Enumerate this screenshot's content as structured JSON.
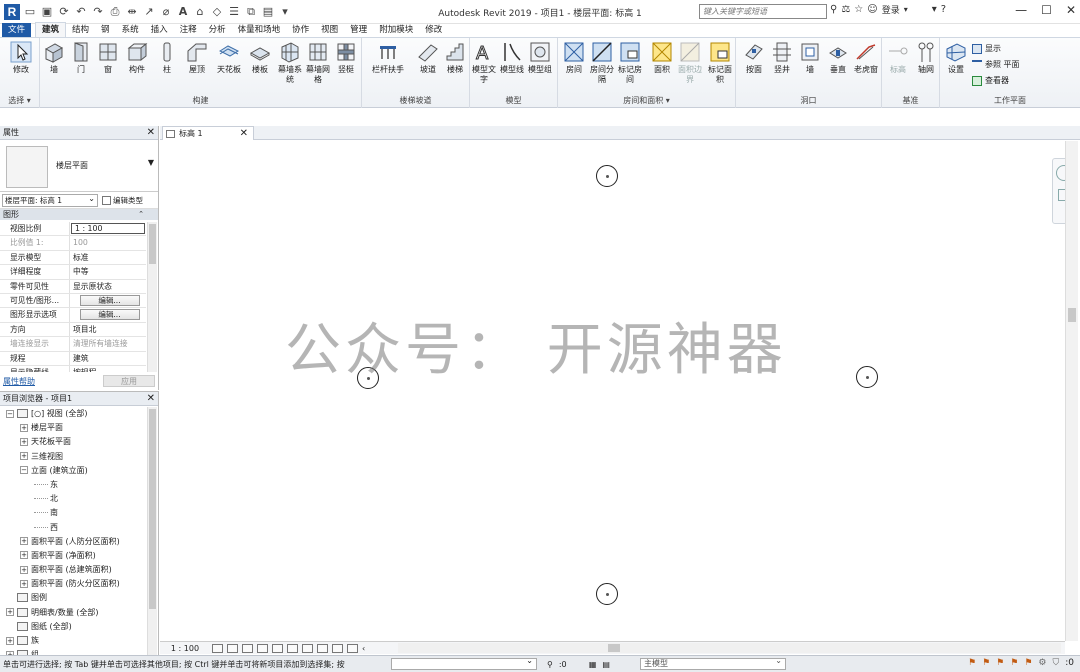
{
  "title": "Autodesk Revit 2019 - 项目1 - 楼层平面: 标高 1",
  "search_placeholder": "键入关键字或短语",
  "user_label": "登录",
  "tabs": [
    "文件",
    "建筑",
    "结构",
    "钢",
    "系统",
    "插入",
    "注释",
    "分析",
    "体量和场地",
    "协作",
    "视图",
    "管理",
    "附加模块",
    "修改"
  ],
  "active_tab": "建筑",
  "ribbon": {
    "select": {
      "label": "修改",
      "panel": "选择"
    },
    "build": {
      "panel": "构建",
      "buttons": [
        "墙",
        "门",
        "窗",
        "构件",
        "柱",
        "屋顶",
        "天花板",
        "楼板",
        "幕墙系统",
        "幕墙网格",
        "竖梃"
      ]
    },
    "circulation": {
      "panel": "楼梯坡道",
      "buttons": [
        "栏杆扶手",
        "坡道",
        "楼梯"
      ]
    },
    "model": {
      "panel": "模型",
      "buttons": [
        "模型文字",
        "模型线",
        "模型组"
      ]
    },
    "room": {
      "panel": "房间和面积",
      "buttons": [
        "房间",
        "房间分隔",
        "标记房间",
        "面积",
        "面积边界",
        "标记面积"
      ]
    },
    "opening": {
      "panel": "洞口",
      "buttons": [
        "按面",
        "竖井",
        "墙",
        "垂直",
        "老虎窗"
      ]
    },
    "datum": {
      "panel": "基准",
      "buttons": [
        "标高",
        "轴网"
      ]
    },
    "workplane": {
      "panel": "工作平面",
      "set_label": "设置",
      "small": [
        "显示",
        "参照 平面",
        "查看器"
      ]
    }
  },
  "properties": {
    "header": "属性",
    "type_name": "楼层平面",
    "instance": "楼层平面: 标高 1",
    "edit_type": "编辑类型",
    "category": "图形",
    "rows": [
      {
        "key": "视图比例",
        "value": "1 : 100",
        "gray": false,
        "boxed": true
      },
      {
        "key": "比例值 1:",
        "value": "100",
        "gray": true
      },
      {
        "key": "显示模型",
        "value": "标准",
        "gray": false
      },
      {
        "key": "详细程度",
        "value": "中等",
        "gray": false
      },
      {
        "key": "零件可见性",
        "value": "显示原状态",
        "gray": false
      },
      {
        "key": "可见性/图形...",
        "value": "编辑...",
        "gray": false,
        "button": true
      },
      {
        "key": "图形显示选项",
        "value": "编辑...",
        "gray": false,
        "button": true
      },
      {
        "key": "方向",
        "value": "项目北",
        "gray": false
      },
      {
        "key": "墙连接显示",
        "value": "清理所有墙连接",
        "gray": true
      },
      {
        "key": "规程",
        "value": "建筑",
        "gray": false
      },
      {
        "key": "显示隐藏线",
        "value": "按规程",
        "gray": false
      }
    ],
    "help_link": "属性帮助",
    "apply_label": "应用"
  },
  "browser": {
    "header": "项目浏览器 - 项目1",
    "nodes": [
      {
        "label": "[○] 视图 (全部)",
        "level": 0,
        "exp": "−"
      },
      {
        "label": "楼层平面",
        "level": 1,
        "exp": "+"
      },
      {
        "label": "天花板平面",
        "level": 1,
        "exp": "+"
      },
      {
        "label": "三维视图",
        "level": 1,
        "exp": "+"
      },
      {
        "label": "立面 (建筑立面)",
        "level": 1,
        "exp": "−"
      },
      {
        "label": "东",
        "level": 2,
        "exp": ""
      },
      {
        "label": "北",
        "level": 2,
        "exp": ""
      },
      {
        "label": "南",
        "level": 2,
        "exp": ""
      },
      {
        "label": "西",
        "level": 2,
        "exp": ""
      },
      {
        "label": "面积平面 (人防分区面积)",
        "level": 1,
        "exp": "+"
      },
      {
        "label": "面积平面 (净面积)",
        "level": 1,
        "exp": "+"
      },
      {
        "label": "面积平面 (总建筑面积)",
        "level": 1,
        "exp": "+"
      },
      {
        "label": "面积平面 (防火分区面积)",
        "level": 1,
        "exp": "+"
      },
      {
        "label": "图例",
        "level": 0,
        "exp": ""
      },
      {
        "label": "明细表/数量 (全部)",
        "level": 0,
        "exp": "+"
      },
      {
        "label": "图纸 (全部)",
        "level": 0,
        "exp": ""
      },
      {
        "label": "族",
        "level": 0,
        "exp": "+"
      },
      {
        "label": "组",
        "level": 0,
        "exp": "+"
      }
    ]
  },
  "view_tab": "标高 1",
  "watermark": "公众号： 开源神器",
  "view_scale": "1 : 100",
  "status": {
    "message": "单击可进行选择; 按 Tab 键并单击可选择其他项目; 按 Ctrl 键并单击可将新项目添加到选择集; 按",
    "selection_count": ":0",
    "model": "主模型",
    "filter_count": ":0"
  }
}
